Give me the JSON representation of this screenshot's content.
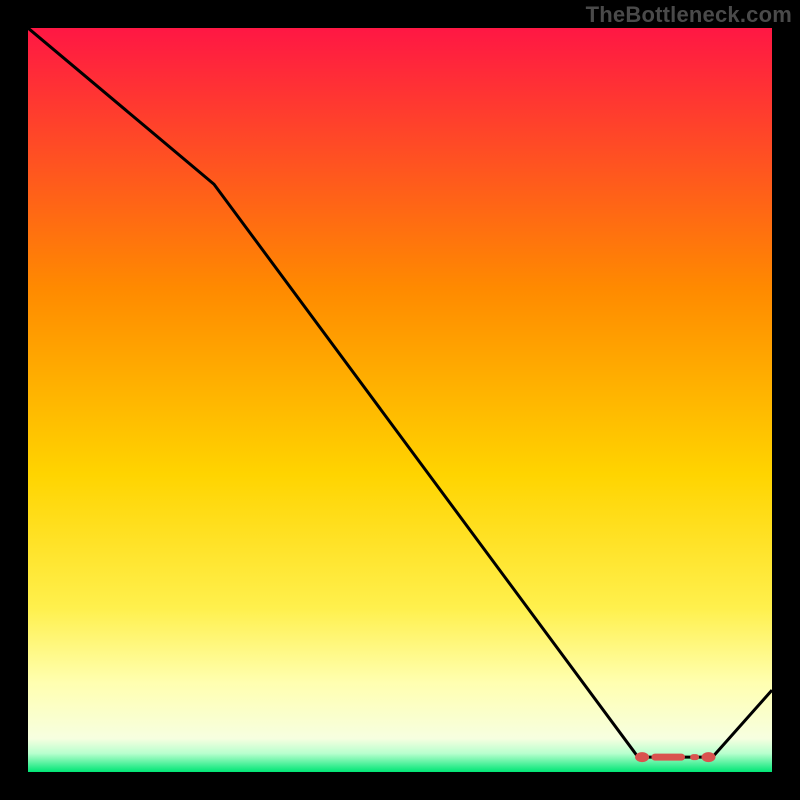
{
  "watermark": "TheBottleneck.com",
  "chart_data": {
    "type": "line",
    "title": "",
    "xlabel": "",
    "ylabel": "",
    "xlim": [
      0,
      100
    ],
    "ylim": [
      0,
      100
    ],
    "x": [
      0,
      25,
      82,
      92,
      100
    ],
    "values": [
      100,
      79,
      2,
      2,
      11
    ],
    "flat_segment": {
      "x_start": 82,
      "x_end": 92,
      "y": 2
    },
    "marker_color": "#d9534f",
    "line_color": "#000000",
    "gradient_stops": [
      {
        "offset": 0.0,
        "color": "#ff1744"
      },
      {
        "offset": 0.35,
        "color": "#ff8a00"
      },
      {
        "offset": 0.6,
        "color": "#ffd400"
      },
      {
        "offset": 0.78,
        "color": "#fff04d"
      },
      {
        "offset": 0.88,
        "color": "#ffffb0"
      },
      {
        "offset": 0.955,
        "color": "#f7ffe0"
      },
      {
        "offset": 0.975,
        "color": "#b8ffce"
      },
      {
        "offset": 1.0,
        "color": "#00e676"
      }
    ]
  }
}
